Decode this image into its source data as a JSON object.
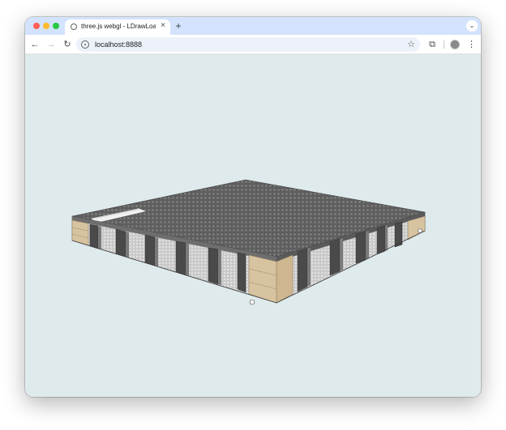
{
  "browser": {
    "tab": {
      "title": "three.js webgl - LDrawLoader"
    },
    "address_bar": {
      "url": "localhost:8888"
    }
  },
  "viewport": {
    "background": "#dfeaec",
    "scene": {
      "model": "lego-baseplate-platform",
      "top_color": "#5c5c5c",
      "tan_color": "#d8c3a0"
    }
  }
}
